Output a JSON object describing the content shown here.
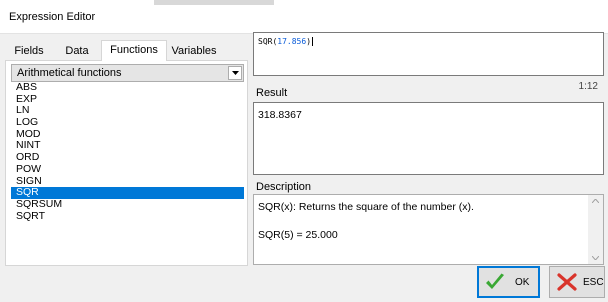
{
  "window": {
    "title": "Expression Editor"
  },
  "tabs": [
    {
      "label": "Fields",
      "active": false
    },
    {
      "label": "Data",
      "active": false
    },
    {
      "label": "Functions",
      "active": true
    },
    {
      "label": "Variables",
      "active": false
    }
  ],
  "category": {
    "selected": "Arithmetical functions"
  },
  "functions": {
    "items": [
      "ABS",
      "EXP",
      "LN",
      "LOG",
      "MOD",
      "NINT",
      "ORD",
      "POW",
      "SIGN",
      "SQR",
      "SQRSUM",
      "SQRT"
    ],
    "selected": "SQR"
  },
  "editor": {
    "fn": "SQR",
    "open": "(",
    "arg": "17.856",
    "close": ")",
    "cursor_position": "1:12"
  },
  "result": {
    "label": "Result",
    "value": "318.8367"
  },
  "description": {
    "label": "Description",
    "line1": "SQR(x): Returns the square of the number (x).",
    "line2": "SQR(5) = 25.000"
  },
  "buttons": {
    "ok_label": "OK",
    "esc_label": "ESC"
  },
  "colors": {
    "selection": "#0078d7",
    "ok_icon": "#3aa834",
    "esc_icon": "#d9342b",
    "number_token": "#0a5bd8"
  }
}
